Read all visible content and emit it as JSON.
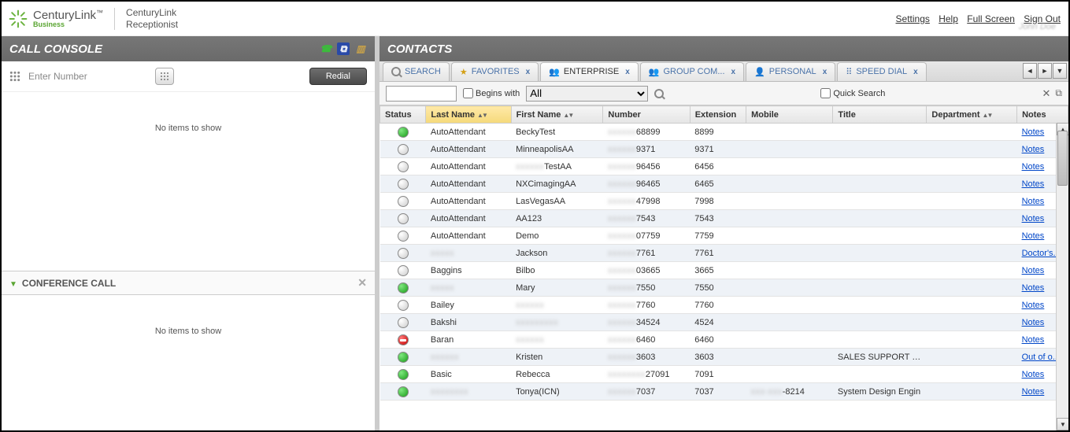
{
  "brand": {
    "name_main": "CenturyLink",
    "name_tm": "™",
    "name_sub": "Business",
    "app_line1": "CenturyLink",
    "app_line2": "Receptionist"
  },
  "top_links": {
    "settings": "Settings",
    "help": "Help",
    "fullscreen": "Full Screen",
    "signout": "Sign Out"
  },
  "call_console": {
    "title": "CALL CONSOLE",
    "enter_number": "Enter Number",
    "redial": "Redial",
    "empty": "No items to show"
  },
  "conference": {
    "title": "CONFERENCE CALL",
    "empty": "No items to show"
  },
  "contacts_title": "CONTACTS",
  "tabs": {
    "search": "SEARCH",
    "favorites": "FAVORITES",
    "enterprise": "ENTERPRISE",
    "groupcom": "GROUP COM...",
    "personal": "PERSONAL",
    "speeddial": "SPEED DIAL"
  },
  "filter": {
    "begins_with": "Begins with",
    "all_option": "All",
    "quick_search": "Quick Search"
  },
  "columns": {
    "status": "Status",
    "last_name": "Last Name",
    "first_name": "First Name",
    "number": "Number",
    "extension": "Extension",
    "mobile": "Mobile",
    "title": "Title",
    "department": "Department",
    "notes": "Notes"
  },
  "notes_label": "Notes",
  "doctors_label": "Doctor's...",
  "outof_label": "Out of o...",
  "rows": [
    {
      "status": "avail",
      "last": "AutoAttendant",
      "first": "BeckyTest",
      "num_blur": "xxxxxx",
      "num_end": "68899",
      "ext": "8899",
      "mobile": "",
      "title": "",
      "dept": "",
      "note": "Notes"
    },
    {
      "status": "unknown",
      "last": "AutoAttendant",
      "first": "MinneapolisAA",
      "num_blur": "xxxxxx",
      "num_end": "9371",
      "ext": "9371",
      "mobile": "",
      "title": "",
      "dept": "",
      "note": "Notes"
    },
    {
      "status": "unknown",
      "last": "AutoAttendant",
      "first_blur": "xxxxxx",
      "first": "TestAA",
      "num_blur": "xxxxxx",
      "num_end": "96456",
      "ext": "6456",
      "mobile": "",
      "title": "",
      "dept": "",
      "note": "Notes"
    },
    {
      "status": "unknown",
      "last": "AutoAttendant",
      "first": "NXCimagingAA",
      "num_blur": "xxxxxx",
      "num_end": "96465",
      "ext": "6465",
      "mobile": "",
      "title": "",
      "dept": "",
      "note": "Notes"
    },
    {
      "status": "unknown",
      "last": "AutoAttendant",
      "first": "LasVegasAA",
      "num_blur": "xxxxxx",
      "num_end": "47998",
      "ext": "7998",
      "mobile": "",
      "title": "",
      "dept": "",
      "note": "Notes"
    },
    {
      "status": "unknown",
      "last": "AutoAttendant",
      "first": "AA123",
      "num_blur": "xxxxxx",
      "num_end": "7543",
      "ext": "7543",
      "mobile": "",
      "title": "",
      "dept": "",
      "note": "Notes"
    },
    {
      "status": "unknown",
      "last": "AutoAttendant",
      "first": "Demo",
      "num_blur": "xxxxxx",
      "num_end": "07759",
      "ext": "7759",
      "mobile": "",
      "title": "",
      "dept": "",
      "note": "Notes"
    },
    {
      "status": "unknown",
      "last_blur": "xxxxx",
      "last": "",
      "first": "Jackson",
      "num_blur": "xxxxxx",
      "num_end": "7761",
      "ext": "7761",
      "mobile": "",
      "title": "",
      "dept": "",
      "note": "Doctor's..."
    },
    {
      "status": "unknown",
      "last": "Baggins",
      "first": "Bilbo",
      "num_blur": "xxxxxx",
      "num_end": "03665",
      "ext": "3665",
      "mobile": "",
      "title": "",
      "dept": "",
      "note": "Notes"
    },
    {
      "status": "avail",
      "last_blur": "xxxxx",
      "last": "",
      "first": "Mary",
      "num_blur": "xxxxxx",
      "num_end": "7550",
      "ext": "7550",
      "mobile": "",
      "title": "",
      "dept": "",
      "note": "Notes"
    },
    {
      "status": "unknown",
      "last": "Bailey",
      "first_blur": "xxxxxx",
      "first": "",
      "num_blur": "xxxxxx",
      "num_end": "7760",
      "ext": "7760",
      "mobile": "",
      "title": "",
      "dept": "",
      "note": "Notes"
    },
    {
      "status": "unknown",
      "last": "Bakshi",
      "first_blur": "xxxxxxxxx",
      "first": "",
      "num_blur": "xxxxxx",
      "num_end": "34524",
      "ext": "4524",
      "mobile": "",
      "title": "",
      "dept": "",
      "note": "Notes"
    },
    {
      "status": "dnd",
      "last": "Baran",
      "first_blur": "xxxxxx",
      "first": "",
      "num_blur": "xxxxxx",
      "num_end": "6460",
      "ext": "6460",
      "mobile": "",
      "title": "",
      "dept": "",
      "note": "Notes"
    },
    {
      "status": "avail",
      "last_blur": "xxxxxx",
      "last": "",
      "first": "Kristen",
      "num_blur": "xxxxxx",
      "num_end": "3603",
      "ext": "3603",
      "mobile": "",
      "title": "SALES SUPPORT REI",
      "dept": "",
      "note": "Out of o..."
    },
    {
      "status": "avail",
      "last": "Basic",
      "first": "Rebecca",
      "num_blur": "xxxxxxxx",
      "num_end": "27091",
      "ext": "7091",
      "mobile": "",
      "title": "",
      "dept": "",
      "note": "Notes"
    },
    {
      "status": "avail",
      "last_blur": "xxxxxxxx",
      "last": "",
      "first": "Tonya(ICN)",
      "num_blur": "xxxxxx",
      "num_end": "7037",
      "ext": "7037",
      "mobile_blur": "xxx-xxx",
      "mobile": "-8214",
      "title": "System Design Engin",
      "dept": "",
      "note": "Notes"
    }
  ]
}
